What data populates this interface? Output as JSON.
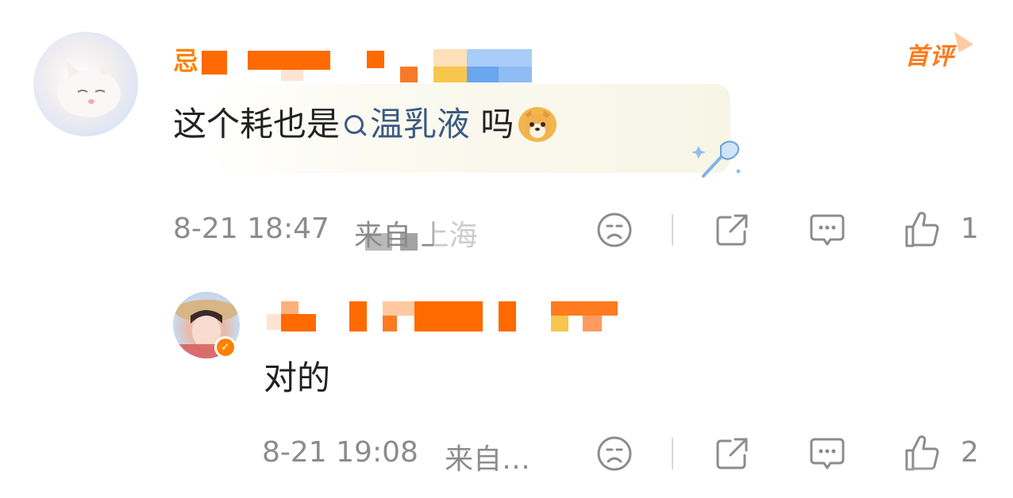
{
  "comment": {
    "author_partial": "忌",
    "badge": "首评",
    "text_prefix": "这个耗也是",
    "topic": "温乳液",
    "text_suffix": " 吗",
    "emoji": "dog-emoji",
    "timestamp": "8-21 18:47",
    "source": "来自 上海",
    "like_count": "1"
  },
  "reply": {
    "text": "对的",
    "timestamp": "8-21 19:08",
    "source": "来自…",
    "like_count": "2"
  },
  "colors": {
    "accent_orange": "#ff8200",
    "topic_blue": "#3b5a83",
    "meta_gray": "#8c8c8c"
  }
}
